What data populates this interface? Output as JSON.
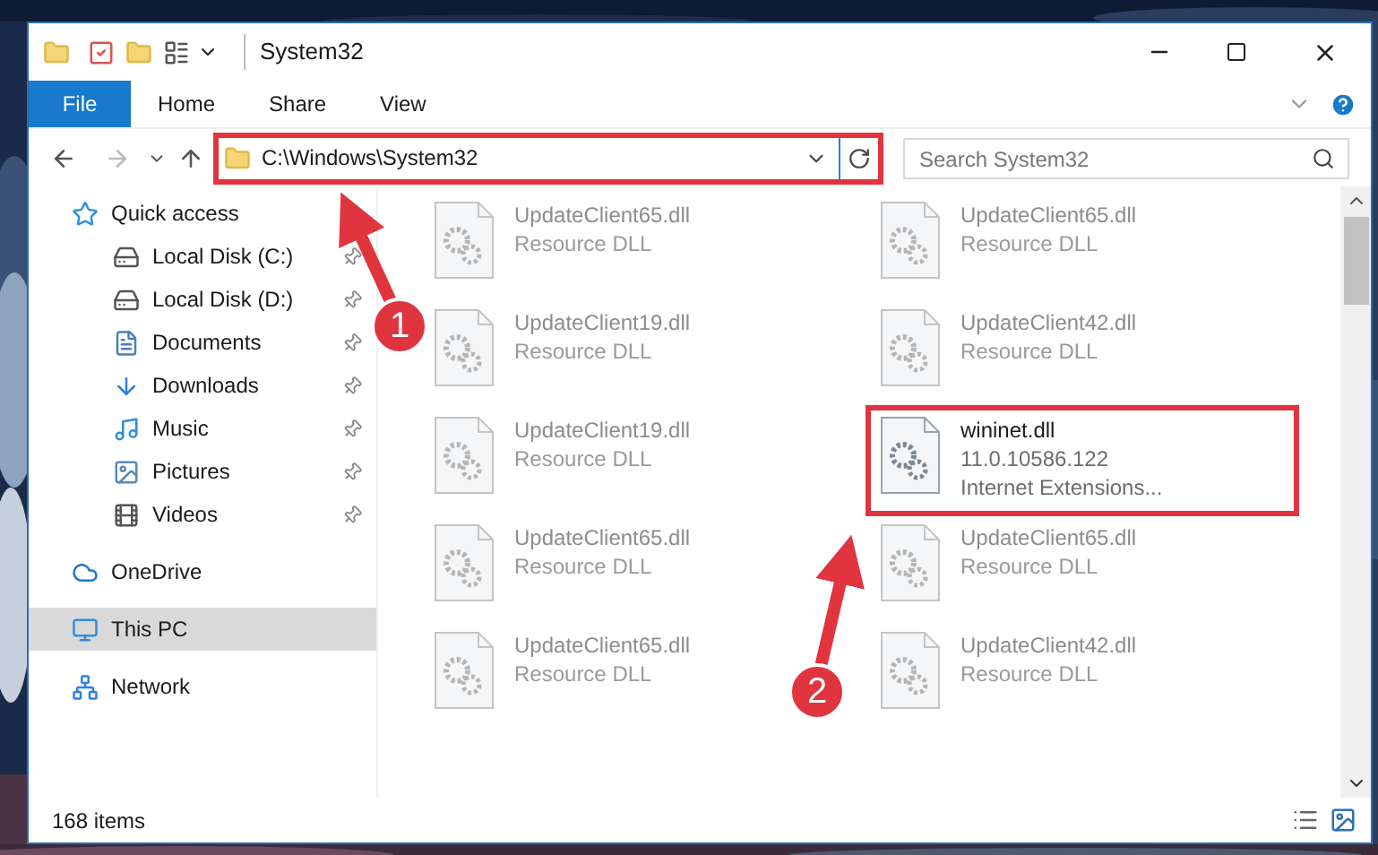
{
  "window": {
    "title": "System32"
  },
  "ribbon_tabs": [
    {
      "label": "File",
      "kind": "file"
    },
    {
      "label": "Home",
      "kind": "tab"
    },
    {
      "label": "Share",
      "kind": "tab"
    },
    {
      "label": "View",
      "kind": "tab"
    }
  ],
  "address_bar": {
    "path": "C:\\Windows\\System32",
    "highlighted": true
  },
  "search": {
    "placeholder": "Search System32"
  },
  "sidebar": {
    "items": [
      {
        "label": "Quick access",
        "kind": "star",
        "selected": false,
        "children": [
          {
            "label": "Local Disk (C:)",
            "kind": "drive",
            "pinned": true
          },
          {
            "label": "Local Disk (D:)",
            "kind": "drive",
            "pinned": true
          },
          {
            "label": "Documents",
            "kind": "documents",
            "pinned": true
          },
          {
            "label": "Downloads",
            "kind": "downloads",
            "pinned": true
          },
          {
            "label": "Music",
            "kind": "music",
            "pinned": true
          },
          {
            "label": "Pictures",
            "kind": "pictures",
            "pinned": true
          },
          {
            "label": "Videos",
            "kind": "videos",
            "pinned": true
          }
        ]
      },
      {
        "label": "OneDrive",
        "kind": "cloud",
        "selected": false
      },
      {
        "label": "This PC",
        "kind": "computer",
        "selected": true
      },
      {
        "label": "Network",
        "kind": "network",
        "selected": false
      }
    ]
  },
  "files": [
    {
      "name": "UpdateClient65.dll",
      "lines": [
        "Resource DLL"
      ],
      "blurred": true,
      "highlighted": false
    },
    {
      "name": "UpdateClient65.dll",
      "lines": [
        "Resource DLL"
      ],
      "blurred": true,
      "highlighted": false
    },
    {
      "name": "UpdateClient19.dll",
      "lines": [
        "Resource DLL"
      ],
      "blurred": true,
      "highlighted": false
    },
    {
      "name": "UpdateClient42.dll",
      "lines": [
        "Resource DLL"
      ],
      "blurred": true,
      "highlighted": false
    },
    {
      "name": "UpdateClient19.dll",
      "lines": [
        "Resource DLL"
      ],
      "blurred": true,
      "highlighted": false
    },
    {
      "name": "wininet.dll",
      "lines": [
        "11.0.10586.122",
        "Internet Extensions..."
      ],
      "blurred": false,
      "highlighted": true
    },
    {
      "name": "UpdateClient65.dll",
      "lines": [
        "Resource DLL"
      ],
      "blurred": true,
      "highlighted": false
    },
    {
      "name": "UpdateClient65.dll",
      "lines": [
        "Resource DLL"
      ],
      "blurred": true,
      "highlighted": false
    },
    {
      "name": "UpdateClient65.dll",
      "lines": [
        "Resource DLL"
      ],
      "blurred": true,
      "highlighted": false
    },
    {
      "name": "UpdateClient42.dll",
      "lines": [
        "Resource DLL"
      ],
      "blurred": true,
      "highlighted": false
    }
  ],
  "status_bar": {
    "count": "168 items"
  },
  "annotations": [
    {
      "label": "1"
    },
    {
      "label": "2"
    }
  ]
}
